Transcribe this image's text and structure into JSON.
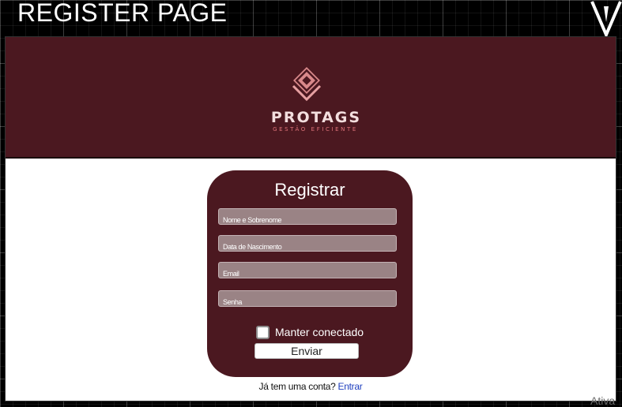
{
  "page_title": "REGISTER PAGE",
  "brand": {
    "name": "PROTAGS",
    "tagline": "GESTÃO EFICIENTE",
    "colors": {
      "maroon": "#4b1820",
      "accent": "#e0747a"
    }
  },
  "form": {
    "title": "Registrar",
    "fields": [
      {
        "placeholder": "Nome e Sobrenome",
        "value": ""
      },
      {
        "placeholder": "Data de Nascimento",
        "value": ""
      },
      {
        "placeholder": "Email",
        "value": ""
      },
      {
        "placeholder": "Senha",
        "value": ""
      }
    ],
    "remember_label": "Manter conectado",
    "remember_checked": false,
    "submit_label": "Enviar"
  },
  "login_prompt": {
    "text": "Já tem uma conta?",
    "link_label": "Entrar"
  },
  "watermark": "Ativa"
}
